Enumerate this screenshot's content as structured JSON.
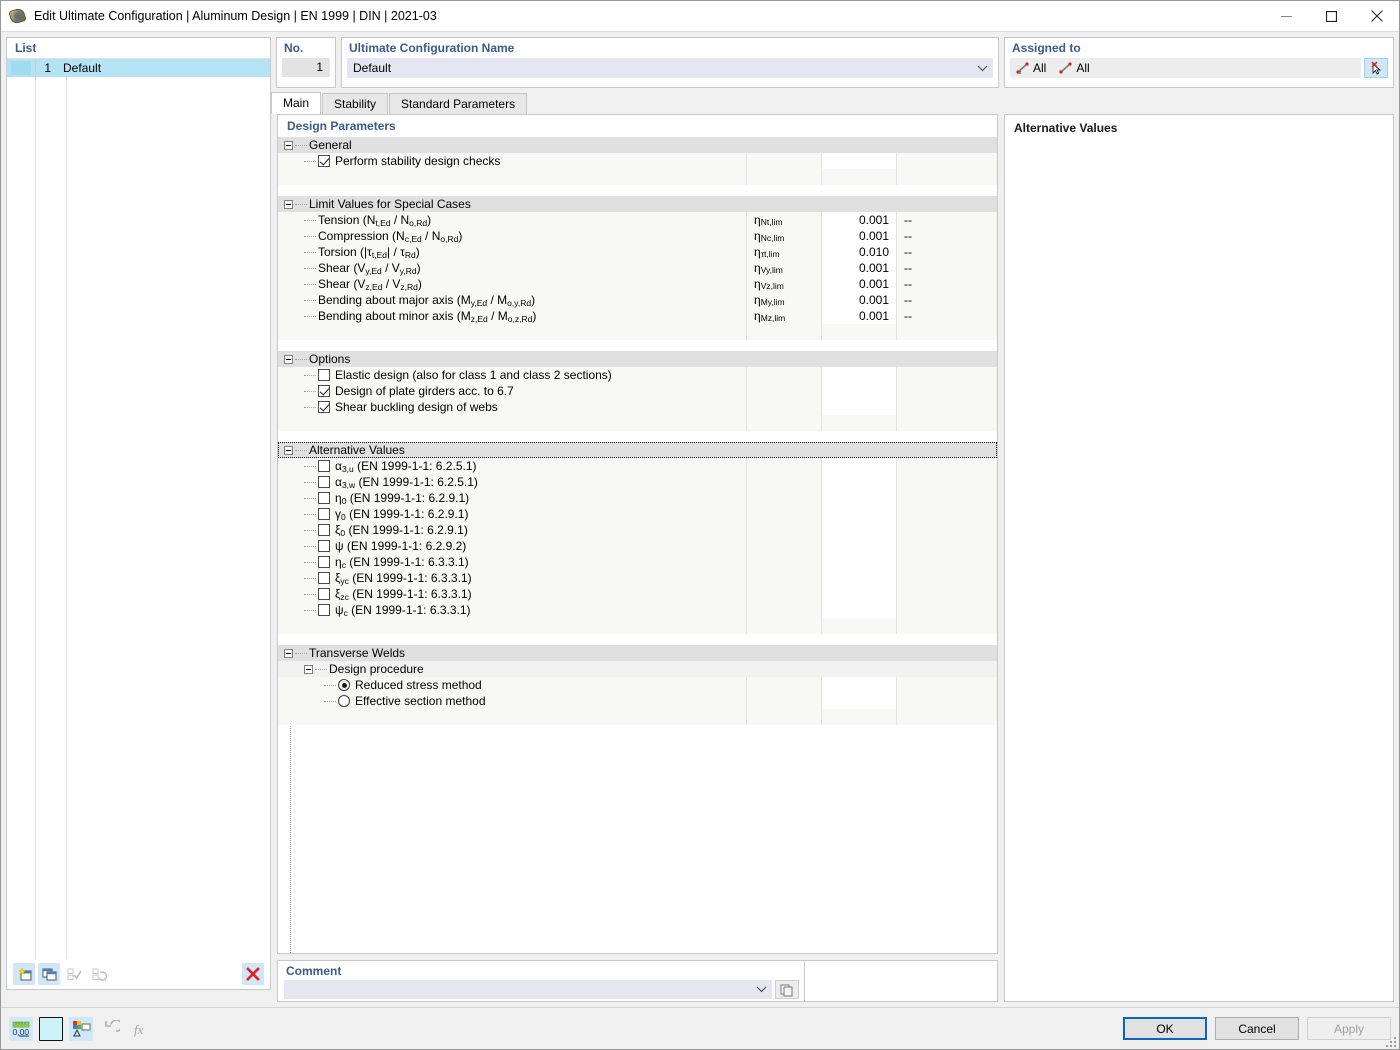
{
  "window": {
    "title": "Edit Ultimate Configuration | Aluminum Design | EN 1999 | DIN | 2021-03",
    "minimize_label": "Minimize",
    "maximize_label": "Maximize",
    "close_label": "Close"
  },
  "list": {
    "header": "List",
    "items": [
      {
        "no": "1",
        "name": "Default"
      }
    ],
    "toolbar": {
      "new": "new-configuration",
      "duplicate": "duplicate-configuration",
      "apply_check": "apply-selection",
      "reset_check": "reset-selection",
      "delete": "delete-configuration"
    }
  },
  "number": {
    "header": "No.",
    "value": "1"
  },
  "config_name": {
    "header": "Ultimate Configuration Name",
    "value": "Default"
  },
  "assigned": {
    "header": "Assigned to",
    "entries": [
      {
        "icon": "member-set-icon",
        "label": "All"
      },
      {
        "icon": "member-icon",
        "label": "All"
      }
    ],
    "select_button": "select-objects"
  },
  "tabs": [
    {
      "label": "Main",
      "active": true
    },
    {
      "label": "Stability",
      "active": false
    },
    {
      "label": "Standard Parameters",
      "active": false
    }
  ],
  "design_parameters": {
    "header": "Design Parameters",
    "groups": [
      {
        "name": "General",
        "rows": [
          {
            "type": "checkbox",
            "checked": true,
            "label": "Perform stability design checks"
          }
        ]
      },
      {
        "name": "Limit Values for Special Cases",
        "rows": [
          {
            "type": "value",
            "label_html": "Tension (N<sub>t,Ed</sub> / N<sub>o,Rd</sub>)",
            "symbol_html": "&#951;<sub>Nt,lim</sub>",
            "value": "0.001",
            "unit": "--"
          },
          {
            "type": "value",
            "label_html": "Compression (N<sub>c,Ed</sub> / N<sub>o,Rd</sub>)",
            "symbol_html": "&#951;<sub>Nc,lim</sub>",
            "value": "0.001",
            "unit": "--"
          },
          {
            "type": "value",
            "label_html": "Torsion (|&#964;<sub>t,Ed</sub>| / &#964;<sub>Rd</sub>)",
            "symbol_html": "&#951;<sub>&#964;t,lim</sub>",
            "value": "0.010",
            "unit": "--"
          },
          {
            "type": "value",
            "label_html": "Shear (V<sub>y,Ed</sub> / V<sub>y,Rd</sub>)",
            "symbol_html": "&#951;<sub>Vy,lim</sub>",
            "value": "0.001",
            "unit": "--"
          },
          {
            "type": "value",
            "label_html": "Shear (V<sub>z,Ed</sub> / V<sub>z,Rd</sub>)",
            "symbol_html": "&#951;<sub>Vz,lim</sub>",
            "value": "0.001",
            "unit": "--"
          },
          {
            "type": "value",
            "label_html": "Bending about major axis (M<sub>y,Ed</sub> / M<sub>o,y,Rd</sub>)",
            "symbol_html": "&#951;<sub>My,lim</sub>",
            "value": "0.001",
            "unit": "--"
          },
          {
            "type": "value",
            "label_html": "Bending about minor axis (M<sub>z,Ed</sub> / M<sub>o,z,Rd</sub>)",
            "symbol_html": "&#951;<sub>Mz,lim</sub>",
            "value": "0.001",
            "unit": "--"
          }
        ]
      },
      {
        "name": "Options",
        "rows": [
          {
            "type": "checkbox",
            "checked": false,
            "label": "Elastic design (also for class 1 and class 2 sections)"
          },
          {
            "type": "checkbox",
            "checked": true,
            "label": "Design of plate girders acc. to 6.7"
          },
          {
            "type": "checkbox",
            "checked": true,
            "label": "Shear buckling design of webs"
          }
        ]
      },
      {
        "name": "Alternative Values",
        "focused": true,
        "rows": [
          {
            "type": "checkbox",
            "checked": false,
            "label_html": "&#945;<sub>3,u</sub> (EN 1999-1-1: 6.2.5.1)"
          },
          {
            "type": "checkbox",
            "checked": false,
            "label_html": "&#945;<sub>3,w</sub> (EN 1999-1-1: 6.2.5.1)"
          },
          {
            "type": "checkbox",
            "checked": false,
            "label_html": "&#951;<sub>0</sub> (EN 1999-1-1: 6.2.9.1)"
          },
          {
            "type": "checkbox",
            "checked": false,
            "label_html": "&#947;<sub>0</sub> (EN 1999-1-1: 6.2.9.1)"
          },
          {
            "type": "checkbox",
            "checked": false,
            "label_html": "&#958;<sub>0</sub> (EN 1999-1-1: 6.2.9.1)"
          },
          {
            "type": "checkbox",
            "checked": false,
            "label_html": "&#968; (EN 1999-1-1: 6.2.9.2)"
          },
          {
            "type": "checkbox",
            "checked": false,
            "label_html": "&#951;<sub>c</sub> (EN 1999-1-1: 6.3.3.1)"
          },
          {
            "type": "checkbox",
            "checked": false,
            "label_html": "&#958;<sub>yc</sub> (EN 1999-1-1: 6.3.3.1)"
          },
          {
            "type": "checkbox",
            "checked": false,
            "label_html": "&#958;<sub>zc</sub> (EN 1999-1-1: 6.3.3.1)"
          },
          {
            "type": "checkbox",
            "checked": false,
            "label_html": "&#968;<sub>c</sub> (EN 1999-1-1: 6.3.3.1)"
          }
        ]
      },
      {
        "name": "Transverse Welds",
        "subgroup": "Design procedure",
        "rows": [
          {
            "type": "radio",
            "checked": true,
            "label": "Reduced stress method"
          },
          {
            "type": "radio",
            "checked": false,
            "label": "Effective section method"
          }
        ]
      }
    ]
  },
  "alternative_values_panel": {
    "header": "Alternative Values"
  },
  "comment": {
    "header": "Comment",
    "value": "",
    "button": "comment-library-button"
  },
  "status_toolbar": {
    "units": "units-icon",
    "color": "color-swatch-icon",
    "display": "display-properties-icon",
    "undo": "undo-icon",
    "formula": "formula-icon"
  },
  "dialog_buttons": [
    {
      "label": "OK",
      "style": "primary",
      "enabled": true
    },
    {
      "label": "Cancel",
      "style": "normal",
      "enabled": true
    },
    {
      "label": "Apply",
      "style": "disabled",
      "enabled": false
    }
  ]
}
